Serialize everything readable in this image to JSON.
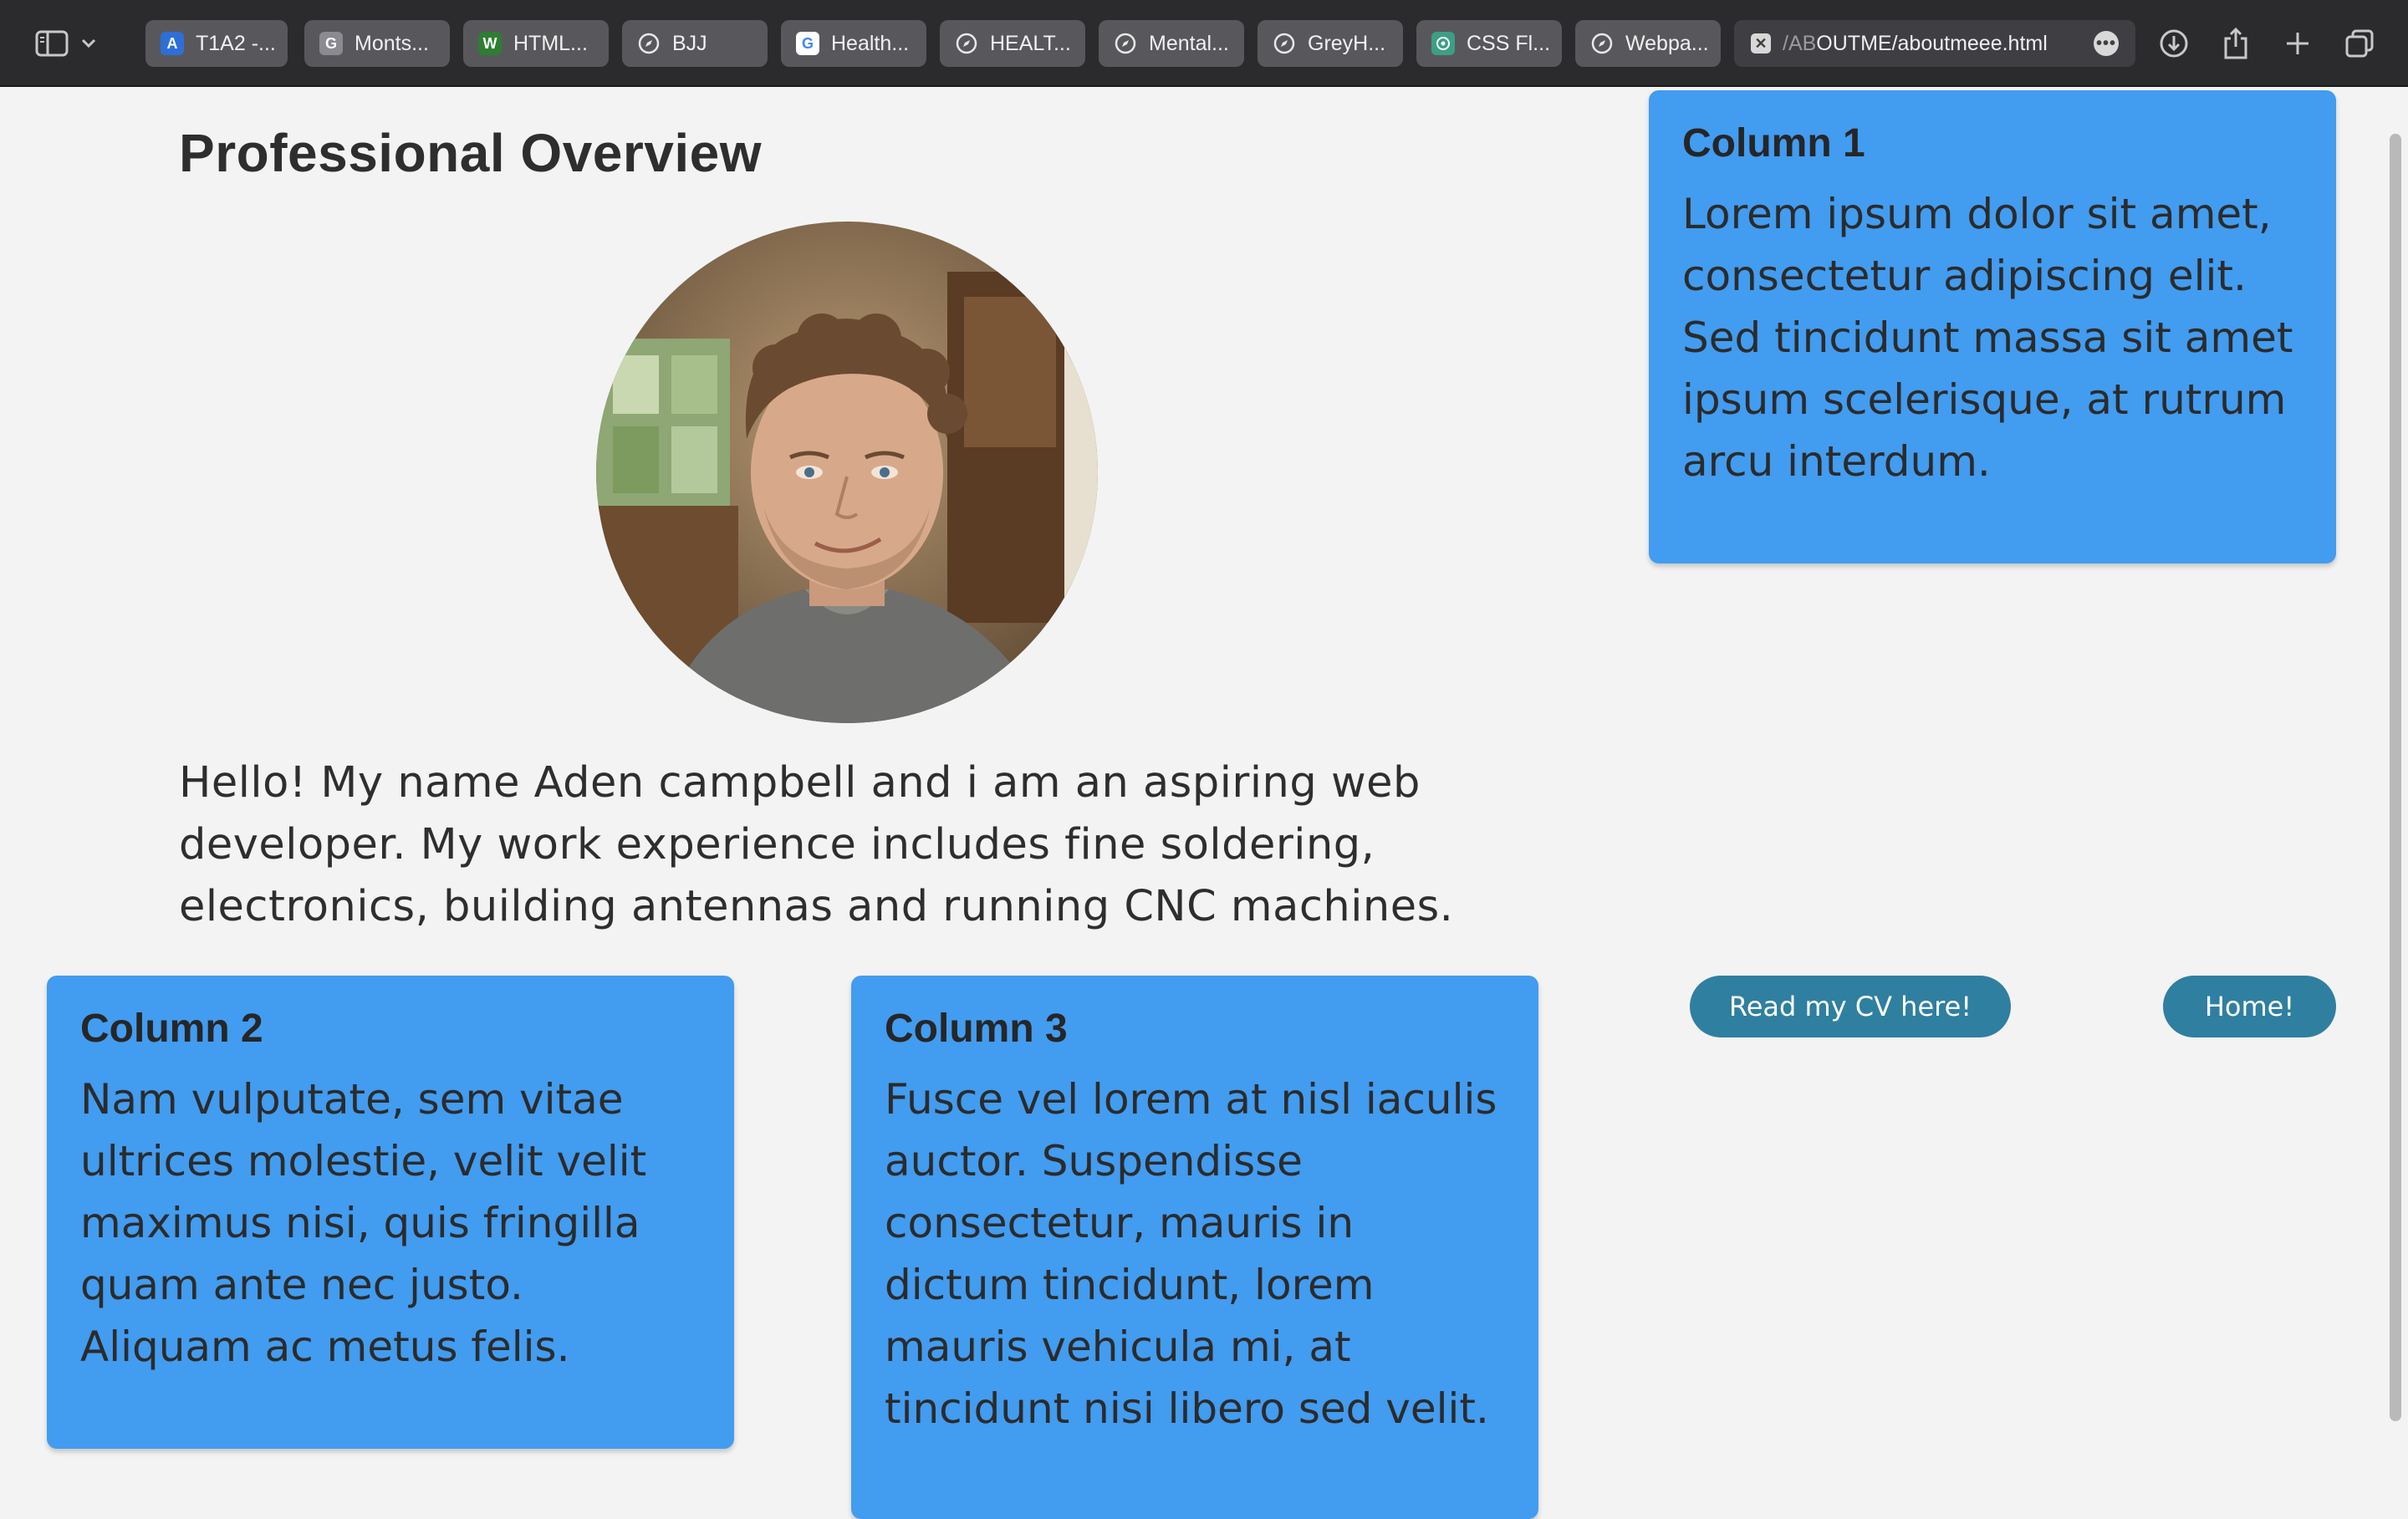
{
  "browser": {
    "tabs": [
      {
        "label": "T1A2 -...",
        "icon": "app-icon",
        "color": "#2d6fd6"
      },
      {
        "label": "Monts...",
        "icon": "google-fonts-icon",
        "color": "#8a8a90"
      },
      {
        "label": "HTML...",
        "icon": "w-site-icon",
        "color": "#2e7d32"
      },
      {
        "label": "BJJ",
        "icon": "compass-icon",
        "color": "#58585c"
      },
      {
        "label": "Health...",
        "icon": "google-icon",
        "color": "#ffffff"
      },
      {
        "label": "HEALT...",
        "icon": "compass-icon",
        "color": "#58585c"
      },
      {
        "label": "Mental...",
        "icon": "compass-icon",
        "color": "#58585c"
      },
      {
        "label": "GreyH...",
        "icon": "compass-icon",
        "color": "#58585c"
      },
      {
        "label": "CSS Fl...",
        "icon": "chatgpt-icon",
        "color": "#3c9f83"
      },
      {
        "label": "Webpa...",
        "icon": "compass-icon",
        "color": "#58585c"
      }
    ],
    "active_tab": {
      "path_prefix": "/AB",
      "path_main": "OUTME/aboutmeee.html",
      "icon": "close-icon"
    }
  },
  "page": {
    "heading": "Professional Overview",
    "intro": "Hello! My name Aden campbell and i am an aspiring web developer. My work experience includes fine soldering, electronics, building antennas and running CNC machines.",
    "columns": [
      {
        "title": "Column 1",
        "text": "Lorem ipsum dolor sit amet, consectetur adipiscing elit. Sed tincidunt massa sit amet ipsum scelerisque, at rutrum arcu interdum."
      },
      {
        "title": "Column 2",
        "text": "Nam vulputate, sem vitae ultrices molestie, velit velit maximus nisi, quis fringilla quam ante nec justo. Aliquam ac metus felis."
      },
      {
        "title": "Column 3",
        "text": "Fusce vel lorem at nisl iaculis auctor. Suspendisse consectetur, mauris in dictum tincidunt, lorem mauris vehicula mi, at tincidunt nisi libero sed velit."
      }
    ],
    "buttons": {
      "cv": "Read my CV here!",
      "home": "Home!"
    },
    "colors": {
      "card": "#429cf0",
      "button": "#2f7fa1",
      "background": "#f3f3f3"
    }
  }
}
